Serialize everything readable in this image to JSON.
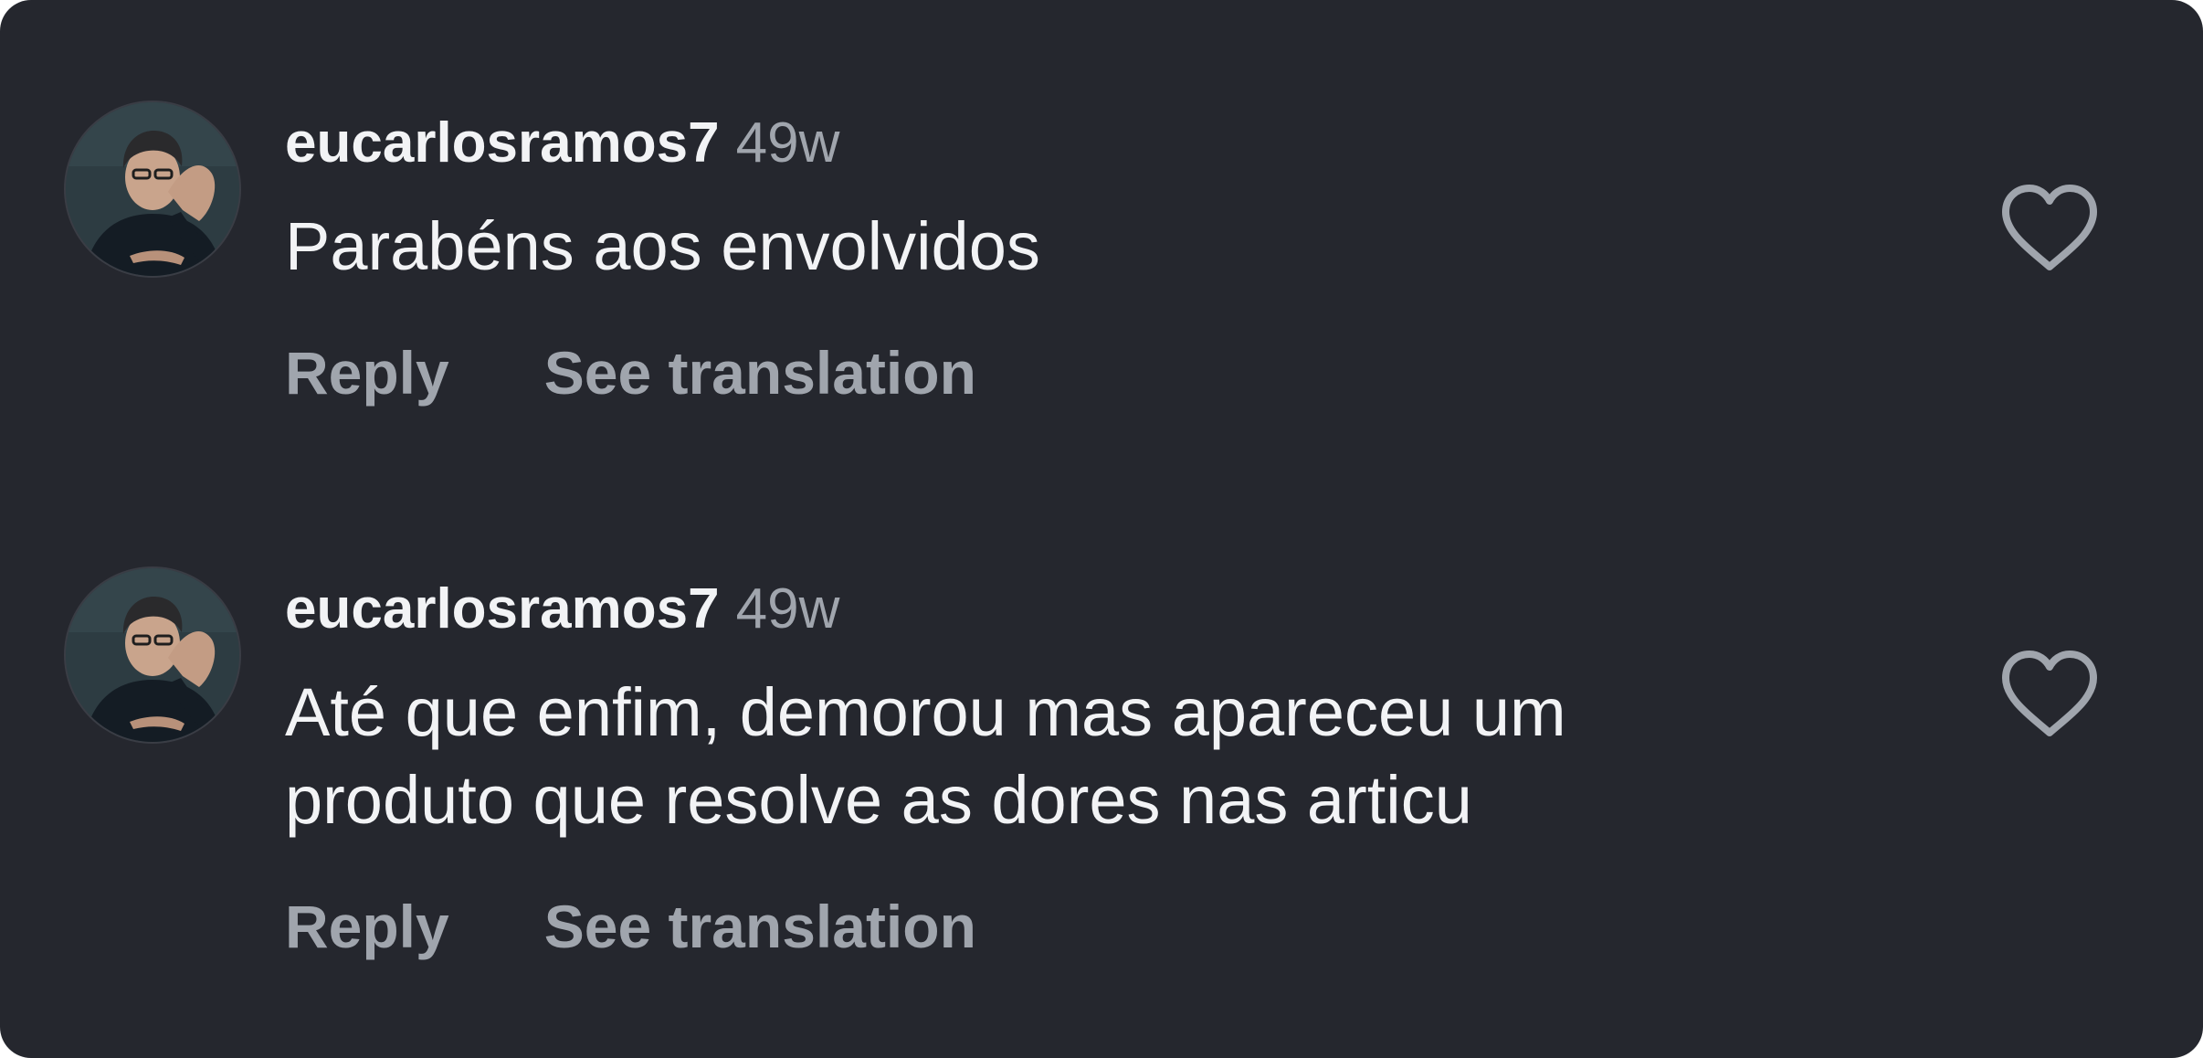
{
  "comments": [
    {
      "username": "eucarlosramos7",
      "time": "49w",
      "text": "Parabéns aos envolvidos",
      "reply_label": "Reply",
      "translate_label": "See translation",
      "like_icon": "heart-outline-icon",
      "avatar": "profile-photo"
    },
    {
      "username": "eucarlosramos7",
      "time": "49w",
      "text": "Até que enfim, demorou mas apareceu um\nproduto que resolve as dores nas articu",
      "reply_label": "Reply",
      "translate_label": "See translation",
      "like_icon": "heart-outline-icon",
      "avatar": "profile-photo"
    }
  ],
  "colors": {
    "background": "#25272e",
    "primary_text": "#f2f3f5",
    "secondary_text": "#a0a5ad"
  }
}
